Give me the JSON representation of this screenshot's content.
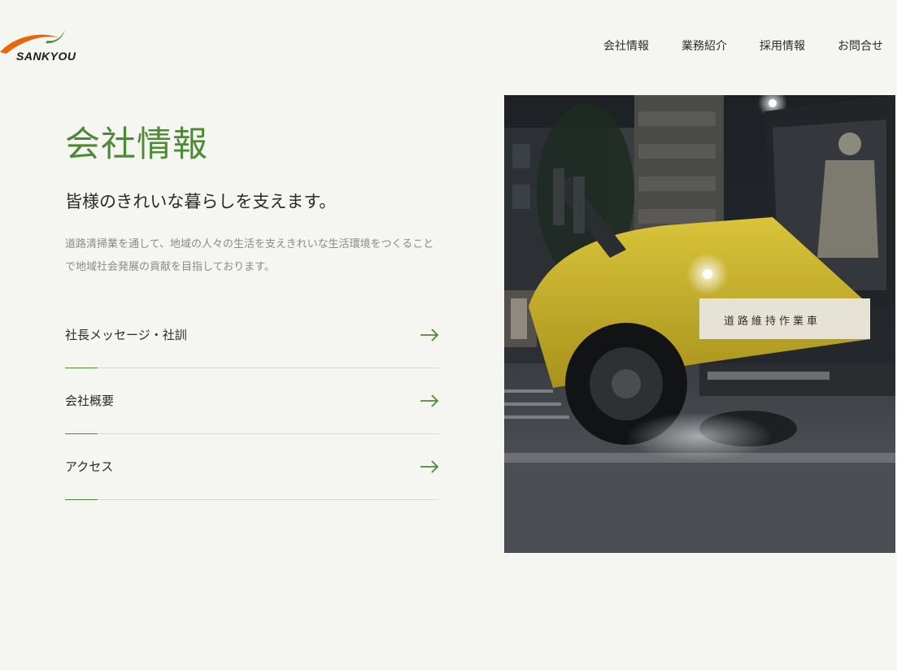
{
  "header": {
    "logo_text": "SANKYOU",
    "nav": [
      {
        "label": "会社情報"
      },
      {
        "label": "業務紹介"
      },
      {
        "label": "採用情報"
      },
      {
        "label": "お問合せ"
      }
    ]
  },
  "main": {
    "title": "会社情報",
    "subtitle": "皆様のきれいな暮らしを支えます。",
    "description": "道路清掃業を通して、地域の人々の生活を支えきれいな生活環境をつくることで地域社会発展の貢献を目指しております。",
    "links": [
      {
        "label": "社長メッセージ・社訓",
        "icon": "arrow-right-icon"
      },
      {
        "label": "会社概要",
        "icon": "arrow-right-icon"
      },
      {
        "label": "アクセス",
        "icon": "arrow-right-icon"
      }
    ]
  },
  "photo": {
    "vehicle_text": "道路維持作業車"
  },
  "colors": {
    "accent": "#4e8a36",
    "logo_orange": "#e8650a",
    "logo_green": "#4e8a36",
    "background": "#f5f6f1",
    "vehicle_yellow": "#c9b32a"
  }
}
